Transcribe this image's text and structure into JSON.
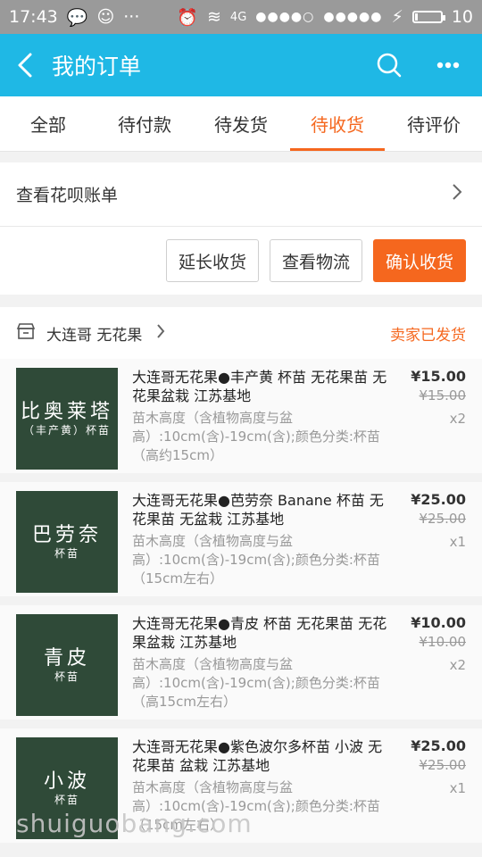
{
  "statusbar": {
    "time": "17:43",
    "network": "4G",
    "battery": "10",
    "battery_level": 0.1
  },
  "header": {
    "title": "我的订单"
  },
  "tabs": [
    {
      "label": "全部"
    },
    {
      "label": "待付款"
    },
    {
      "label": "待发货"
    },
    {
      "label": "待收货",
      "active": true
    },
    {
      "label": "待评价"
    }
  ],
  "huabei": {
    "label": "查看花呗账单"
  },
  "actions": {
    "extend": "延长收货",
    "logistics": "查看物流",
    "confirm": "确认收货"
  },
  "shop": {
    "name": "大连哥 无花果",
    "status": "卖家已发货"
  },
  "items": [
    {
      "thumb_text": "比奥莱塔",
      "thumb_sub": "（丰产黄）杯苗",
      "title": "大连哥无花果●丰产黄 杯苗 无花果苗 无花果盆栽 江苏基地",
      "desc": "苗木高度（含植物高度与盆高）:10cm(含)-19cm(含);颜色分类:杯苗（高约15cm）",
      "price": "¥15.00",
      "old_price": "¥15.00",
      "qty": "x2"
    },
    {
      "thumb_text": "巴劳奈",
      "thumb_sub": "杯苗",
      "title": "大连哥无花果●芭劳奈 Banane 杯苗 无花果苗 无盆栽 江苏基地",
      "desc": "苗木高度（含植物高度与盆高）:10cm(含)-19cm(含);颜色分类:杯苗（15cm左右）",
      "price": "¥25.00",
      "old_price": "¥25.00",
      "qty": "x1"
    },
    {
      "thumb_text": "青皮",
      "thumb_sub": "杯苗",
      "title": "大连哥无花果●青皮 杯苗 无花果苗 无花果盆栽 江苏基地",
      "desc": "苗木高度（含植物高度与盆高）:10cm(含)-19cm(含);颜色分类:杯苗（高15cm左右）",
      "price": "¥10.00",
      "old_price": "¥10.00",
      "qty": "x2"
    },
    {
      "thumb_text": "小波",
      "thumb_sub": "杯苗",
      "title": "大连哥无花果●紫色波尔多杯苗 小波 无花果苗 盆栽 江苏基地",
      "desc": "苗木高度（含植物高度与盆高）:10cm(含)-19cm(含);颜色分类:杯苗（15cm左右）",
      "price": "¥25.00",
      "old_price": "¥25.00",
      "qty": "x1"
    }
  ],
  "watermark": "shuiguobang.com",
  "colors": {
    "header": "#1fb8e5",
    "accent": "#f5671e"
  },
  "icons": [
    "back-arrow-icon",
    "search-icon",
    "more-icon",
    "chevron-right-icon",
    "shop-icon"
  ]
}
